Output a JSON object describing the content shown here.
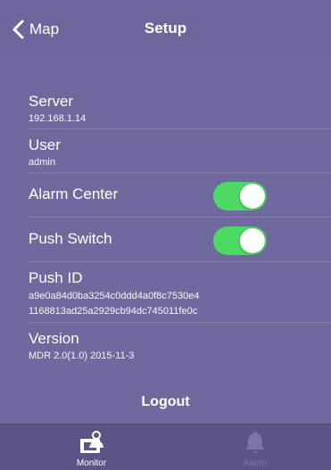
{
  "nav": {
    "back_label": "Map",
    "title": "Setup"
  },
  "settings": {
    "server": {
      "label": "Server",
      "value": "192.168.1.14"
    },
    "user": {
      "label": "User",
      "value": "admin"
    },
    "alarm_center": {
      "label": "Alarm Center",
      "enabled": true
    },
    "push_switch": {
      "label": "Push Switch",
      "enabled": true
    },
    "push_id": {
      "label": "Push ID",
      "value_line1": "a9e0a84d0ba3254c0ddd4a0f8c7530e4",
      "value_line2": "1168813ad25a2929cb94dc745011fe0c"
    },
    "version": {
      "label": "Version",
      "value": "MDR 2.0(1.0) 2015-11-3"
    }
  },
  "logout_label": "Logout",
  "tabs": [
    {
      "label": "Monitor",
      "icon": "monitor-person-icon",
      "active": true
    },
    {
      "label": "Alarm",
      "icon": "bell-icon",
      "active": false
    }
  ],
  "colors": {
    "background": "#6e6a9e",
    "toggle_on": "#4cd964",
    "tabbar": "#595587"
  }
}
